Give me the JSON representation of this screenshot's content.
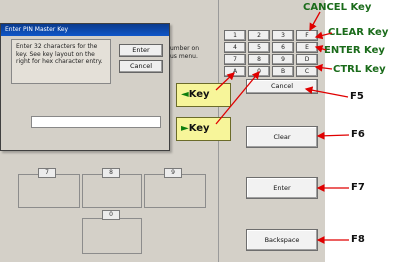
{
  "dialog": {
    "title": "Enter PIN Master Key",
    "message": "Enter 32 characters for the key.  See key layout on the right for hex character entry.",
    "enter_label": "Enter",
    "cancel_label": "Cancel",
    "input_value": ""
  },
  "background": {
    "partial_text_1": "umber on",
    "partial_text_2": "us menu.",
    "slot_labels": [
      "7",
      "8",
      "9",
      "0"
    ]
  },
  "keypad": {
    "rows": [
      [
        "1",
        "2",
        "3",
        "F"
      ],
      [
        "4",
        "5",
        "6",
        "E"
      ],
      [
        "7",
        "8",
        "9",
        "D"
      ],
      [
        "A",
        "0",
        "B",
        "C"
      ]
    ]
  },
  "function_buttons": {
    "cancel": "Cancel",
    "clear": "Clear",
    "enter": "Enter",
    "backspace": "Backspace"
  },
  "callouts": {
    "left_key": "Key",
    "right_key": "Key",
    "left_arrow": "◄",
    "right_arrow": "►"
  },
  "annotations": {
    "cancel_key": "CANCEL Key",
    "clear_key": "CLEAR Key",
    "enter_key": "ENTER Key",
    "ctrl_key": "CTRL Key",
    "f5": "F5",
    "f6": "F6",
    "f7": "F7",
    "f8": "F8"
  },
  "colors": {
    "annotation_green": "#1a6b1a",
    "arrow_red": "#e00000",
    "callout_yellow": "#f7f59a",
    "title_blue": "#0f56c8"
  }
}
